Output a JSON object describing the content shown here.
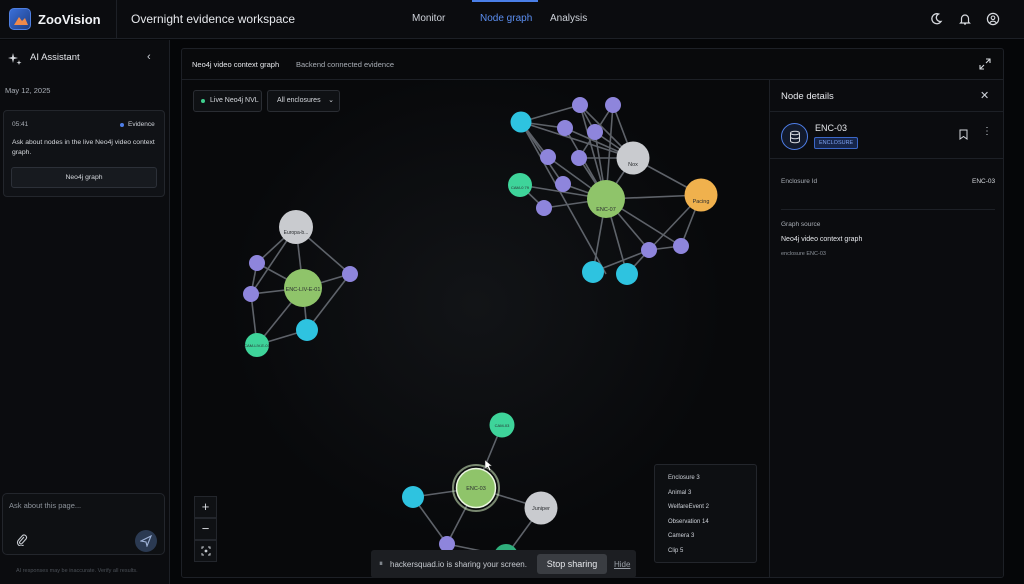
{
  "header": {
    "brand": "ZooVision",
    "workspace": "Overnight evidence workspace",
    "nav": [
      {
        "label": "Monitor"
      },
      {
        "label": "Node graph",
        "active": true
      },
      {
        "label": "Analysis"
      }
    ],
    "icons": [
      "moon-icon",
      "bell-icon",
      "user-circle-icon"
    ]
  },
  "sidebar": {
    "title": "AI Assistant",
    "date": "May 12, 2025",
    "message": {
      "time": "05:41",
      "tag": "Evidence",
      "text": "Ask about nodes in the live Neo4j video context graph.",
      "button_label": "Neo4j graph"
    },
    "input_placeholder": "Ask about this page...",
    "disclaimer": "AI responses may be inaccurate. Verify all results."
  },
  "panel": {
    "title": "Neo4j video context graph",
    "subtitle": "Backend connected evidence",
    "live_chip": "Live Neo4j NVL",
    "filter_select": "All enclosures",
    "nodes": {
      "enc07": "ENC-07",
      "nox": "Nox",
      "pacing": "Pacing",
      "cam": "CAM-0 79",
      "europa": "Europa-b...",
      "enclive": "ENC-LIV-E-01",
      "camliv": "CAM-LIV-E-01",
      "enc03": "ENC-03",
      "cam03": "CAM-03",
      "juniper": "Juniper"
    },
    "legend": [
      "Enclosure 3",
      "Animal 3",
      "WelfareEvent 2",
      "Observation 14",
      "Camera 3",
      "Clip 5"
    ],
    "zoom_in": "+",
    "zoom_out": "−"
  },
  "details": {
    "title": "Node details",
    "node_name": "ENC-03",
    "badge": "ENCLOSURE",
    "property_key": "Enclosure Id",
    "property_value": "ENC-03",
    "source_label": "Graph source",
    "source_value": "Neo4j video context graph",
    "source_sub": "enclosure ENC-03"
  },
  "sharebar": {
    "text": "hackersquad.io is sharing your screen.",
    "stop_label": "Stop sharing",
    "hide_label": "Hide"
  },
  "colors": {
    "enclosure": "#8fc46a",
    "animal": "#c9cbcf",
    "welfare": "#f0b14d",
    "observation": "#8e85dc",
    "camera": "#3ed49a",
    "clip": "#2ec3e0",
    "accent": "#4a7fe8"
  }
}
